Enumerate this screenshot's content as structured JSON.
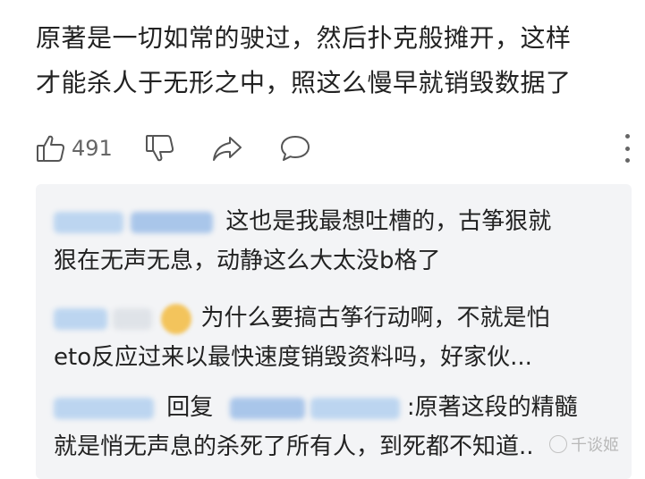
{
  "comment": {
    "line1": "原著是一切如常的驶过，然后扑克般摊开，这样",
    "line2": "才能杀人于无形之中，照这么慢早就销毁数据了"
  },
  "actions": {
    "like_icon": "thumbs-up-icon",
    "like_count": "491",
    "dislike_icon": "thumbs-down-icon",
    "share_icon": "share-icon",
    "comment_icon": "comment-icon",
    "more_icon": "more-vertical-icon"
  },
  "replies": [
    {
      "line1": "这也是我最想吐槽的，古筝狠就",
      "line2": "狠在无声无息，动静这么大太没b格了"
    },
    {
      "line1": "为什么要搞古筝行动啊，不就是怕",
      "line2": "eto反应过来以最快速度销毁资料吗，好家伙..."
    },
    {
      "reply_word": "回复",
      "line1": ":原著这段的精髓",
      "line2": "就是悄无声息的杀死了所有人，到死都不知道.."
    }
  ],
  "watermark": {
    "text": "千谈姬"
  },
  "colors": {
    "background": "#ffffff",
    "reply_box": "#f3f4f6",
    "text": "#222222",
    "muted": "#666666"
  }
}
